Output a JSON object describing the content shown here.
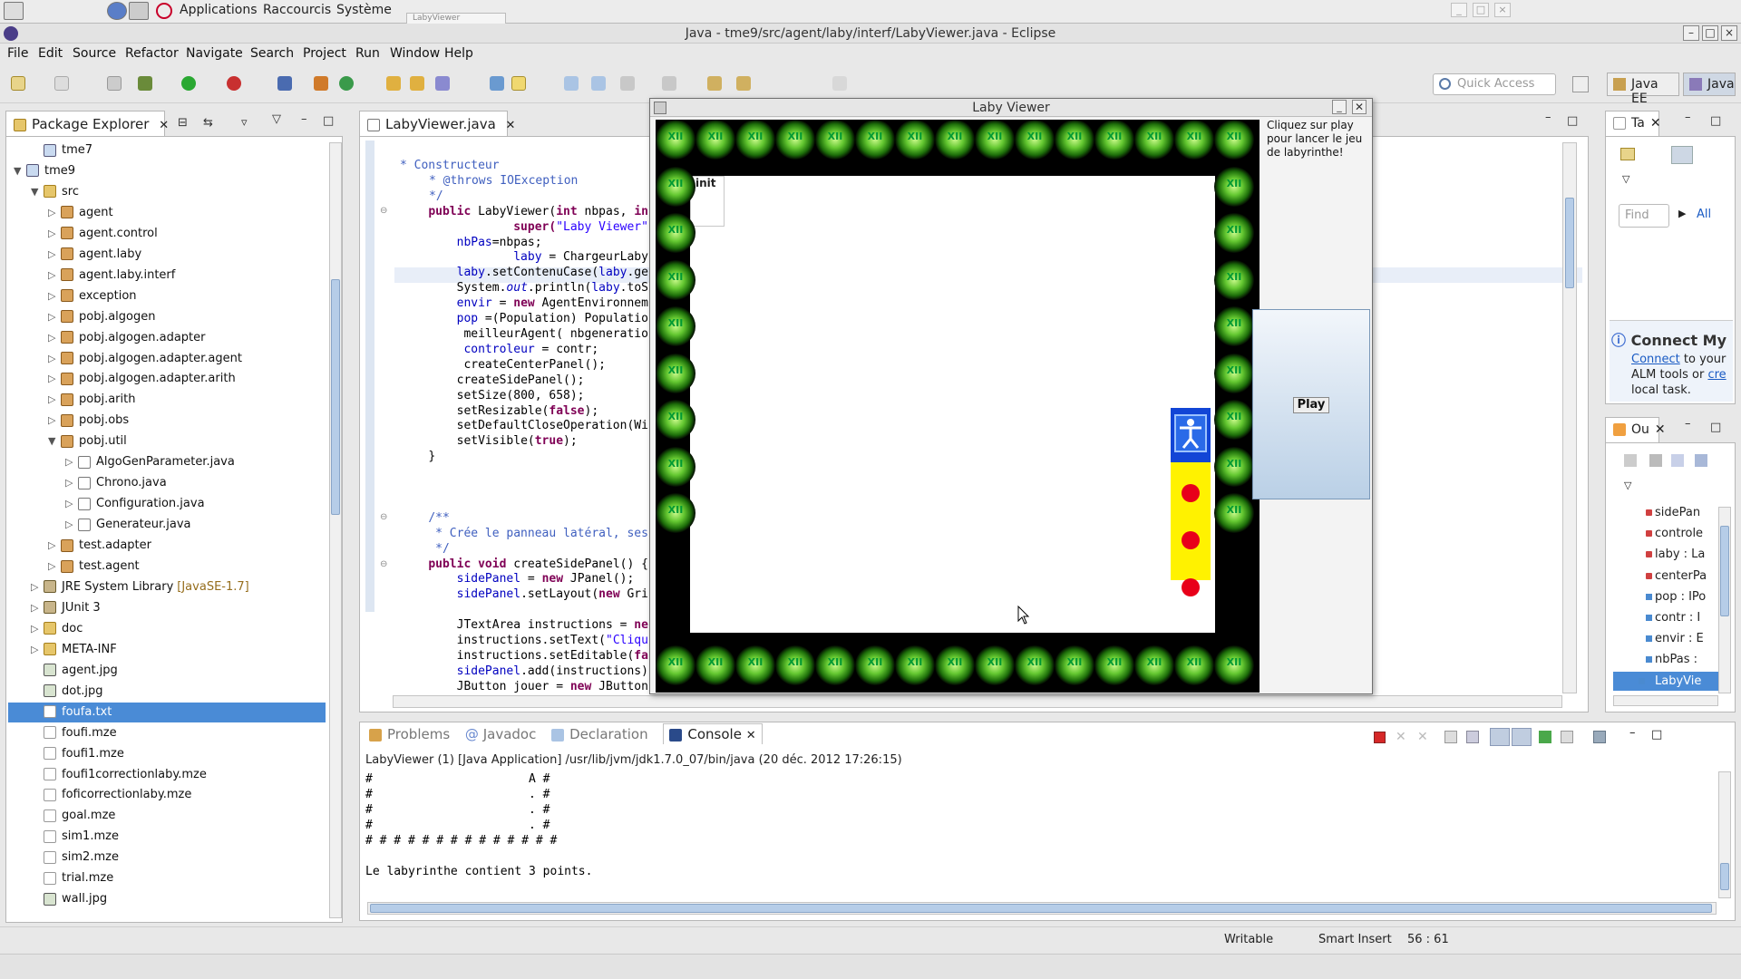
{
  "system_bar": {
    "menus": [
      "Applications",
      "Raccourcis",
      "Système"
    ],
    "task_label": "LabyViewer"
  },
  "window": {
    "title": "Java - tme9/src/agent/laby/interf/LabyViewer.java - Eclipse"
  },
  "menubar": [
    "File",
    "Edit",
    "Source",
    "Refactor",
    "Navigate",
    "Search",
    "Project",
    "Run",
    "Window",
    "Help"
  ],
  "toolbar": {
    "quick_access_placeholder": "Quick Access",
    "perspectives": [
      "Java EE",
      "Java"
    ]
  },
  "package_explorer": {
    "tab_label": "Package Explorer",
    "items": [
      {
        "label": "tme7",
        "icon": "project-icon",
        "level": 1,
        "toggle": ""
      },
      {
        "label": "tme9",
        "icon": "project-icon",
        "level": 0,
        "toggle": "▼"
      },
      {
        "label": "src",
        "icon": "folder-icon",
        "level": 1,
        "toggle": "▼"
      },
      {
        "label": "agent",
        "icon": "package-icon",
        "level": 2,
        "toggle": "▷"
      },
      {
        "label": "agent.control",
        "icon": "package-icon",
        "level": 2,
        "toggle": "▷"
      },
      {
        "label": "agent.laby",
        "icon": "package-icon",
        "level": 2,
        "toggle": "▷"
      },
      {
        "label": "agent.laby.interf",
        "icon": "package-icon",
        "level": 2,
        "toggle": "▷"
      },
      {
        "label": "exception",
        "icon": "package-icon",
        "level": 2,
        "toggle": "▷"
      },
      {
        "label": "pobj.algogen",
        "icon": "package-icon",
        "level": 2,
        "toggle": "▷"
      },
      {
        "label": "pobj.algogen.adapter",
        "icon": "package-icon",
        "level": 2,
        "toggle": "▷"
      },
      {
        "label": "pobj.algogen.adapter.agent",
        "icon": "package-icon",
        "level": 2,
        "toggle": "▷"
      },
      {
        "label": "pobj.algogen.adapter.arith",
        "icon": "package-icon",
        "level": 2,
        "toggle": "▷"
      },
      {
        "label": "pobj.arith",
        "icon": "package-icon",
        "level": 2,
        "toggle": "▷"
      },
      {
        "label": "pobj.obs",
        "icon": "package-icon",
        "level": 2,
        "toggle": "▷"
      },
      {
        "label": "pobj.util",
        "icon": "package-icon",
        "level": 2,
        "toggle": "▼"
      },
      {
        "label": "AlgoGenParameter.java",
        "icon": "java-file-icon",
        "level": 3,
        "toggle": "▷"
      },
      {
        "label": "Chrono.java",
        "icon": "java-file-icon",
        "level": 3,
        "toggle": "▷"
      },
      {
        "label": "Configuration.java",
        "icon": "java-file-icon",
        "level": 3,
        "toggle": "▷"
      },
      {
        "label": "Generateur.java",
        "icon": "java-file-icon",
        "level": 3,
        "toggle": "▷"
      },
      {
        "label": "test.adapter",
        "icon": "package-icon",
        "level": 2,
        "toggle": "▷"
      },
      {
        "label": "test.agent",
        "icon": "package-icon",
        "level": 2,
        "toggle": "▷"
      },
      {
        "label": "JRE System Library",
        "suffix": "[JavaSE-1.7]",
        "icon": "library-icon",
        "level": 1,
        "toggle": "▷"
      },
      {
        "label": "JUnit 3",
        "icon": "library-icon",
        "level": 1,
        "toggle": "▷"
      },
      {
        "label": "doc",
        "icon": "folder-icon",
        "level": 1,
        "toggle": "▷"
      },
      {
        "label": "META-INF",
        "icon": "folder-icon",
        "level": 1,
        "toggle": "▷"
      },
      {
        "label": "agent.jpg",
        "icon": "image-file-icon",
        "level": 1,
        "toggle": ""
      },
      {
        "label": "dot.jpg",
        "icon": "image-file-icon",
        "level": 1,
        "toggle": ""
      },
      {
        "label": "foufa.txt",
        "icon": "text-file-icon",
        "level": 1,
        "toggle": "",
        "selected": true
      },
      {
        "label": "foufi.mze",
        "icon": "text-file-icon",
        "level": 1,
        "toggle": ""
      },
      {
        "label": "foufi1.mze",
        "icon": "text-file-icon",
        "level": 1,
        "toggle": ""
      },
      {
        "label": "foufi1correctionlaby.mze",
        "icon": "text-file-icon",
        "level": 1,
        "toggle": ""
      },
      {
        "label": "foficorrectionlaby.mze",
        "icon": "text-file-icon",
        "level": 1,
        "toggle": ""
      },
      {
        "label": "goal.mze",
        "icon": "text-file-icon",
        "level": 1,
        "toggle": ""
      },
      {
        "label": "sim1.mze",
        "icon": "text-file-icon",
        "level": 1,
        "toggle": ""
      },
      {
        "label": "sim2.mze",
        "icon": "text-file-icon",
        "level": 1,
        "toggle": ""
      },
      {
        "label": "trial.mze",
        "icon": "text-file-icon",
        "level": 1,
        "toggle": ""
      },
      {
        "label": "wall.jpg",
        "icon": "image-file-icon",
        "level": 1,
        "toggle": ""
      }
    ]
  },
  "editor": {
    "tab_label": "LabyViewer.java",
    "code": {
      "l1": "* Constructeur",
      "l2": "* @throws IOException",
      "l3": "*/",
      "l4a": "public ",
      "l4b": "LabyViewer(",
      "l4c": "int",
      "l4d": " nbpas, ",
      "l4e": "in",
      "l5a": "super(",
      "l5b": "\"Laby Viewer\"",
      "l5c": ");",
      "l6a": "nbPas",
      "l6b": "=nbpas;",
      "l7a": "laby",
      "l7b": " = ChargeurLabyrin",
      "l8a": "laby",
      "l8b": ".setContenuCase(",
      "l8c": "laby",
      "l8d": ".ge",
      "l9a": "System.",
      "l9b": "out",
      "l9c": ".println(",
      "l9d": "laby",
      "l9e": ".toS",
      "l10a": "envir",
      "l10b": " = ",
      "l10c": "new",
      "l10d": " AgentEnvironnem",
      "l11a": "pop",
      "l11b": " =(Population) Populatio",
      "l12": " meilleurAgent( nbgeneratio",
      "l13a": " controleur",
      "l13b": " = contr;",
      "l14": " createCenterPanel();",
      "l15": "createSidePanel();",
      "l16": "setSize(800, 658);",
      "l17a": "setResizable(",
      "l17b": "false",
      "l17c": ");",
      "l18": "setDefaultCloseOperation(Wi",
      "l19a": "setVisible(",
      "l19b": "true",
      "l19c": ");",
      "l20": "}",
      "l21": "/**",
      "l22": "* Crée le panneau latéral, ses",
      "l23": "*/",
      "l24a": "public ",
      "l24b": "void",
      "l24c": " createSidePanel() {",
      "l25a": "sidePanel",
      "l25b": " = ",
      "l25c": "new",
      "l25d": " JPanel();",
      "l26a": "sidePanel",
      "l26b": ".setLayout(",
      "l26c": "new",
      "l26d": " Gri",
      "l27a": "JTextArea instructions = ",
      "l27b": "ne",
      "l28a": "instructions.setText(",
      "l28b": "\"Cliqu",
      "l29a": "instructions.setEditable(",
      "l29b": "fa",
      "l30a": "sidePanel",
      "l30b": ".add(instructions)",
      "l31a": "JButton jouer = ",
      "l31b": "new",
      "l31c": " JButton"
    }
  },
  "laby_viewer": {
    "title": "Laby Viewer",
    "init_label": "init",
    "wall_glyph": "XII",
    "instructions": "Cliquez sur play pour lancer le jeu de labyrinthe!",
    "play_label": "Play"
  },
  "right_panels": {
    "tasks_tab": "Ta",
    "find_placeholder": "Find",
    "all_label": "All",
    "connect_title": "Connect My",
    "connect_link": "Connect",
    "connect_text1": " to your",
    "connect_text2": "ALM tools or ",
    "connect_link2": "cre",
    "connect_text3": "local task.",
    "outline_tab": "Ou",
    "outline_items": [
      "sidePan",
      "controle",
      "laby : La",
      "centerPa",
      "pop : IPo",
      "contr : I",
      "envir : E",
      "nbPas :",
      "LabyVie"
    ]
  },
  "bottom_tabs": [
    "Problems",
    "Javadoc",
    "Declaration",
    "Console"
  ],
  "console": {
    "header": "LabyViewer (1) [Java Application] /usr/lib/jvm/jdk1.7.0_07/bin/java (20 déc. 2012 17:26:15)",
    "lines": [
      "#                      A #",
      "#                      . #",
      "#                      . #",
      "#                      . #",
      "# # # # # # # # # # # # # #",
      "",
      "Le labyrinthe contient 3 points."
    ]
  },
  "status_bar": {
    "writable": "Writable",
    "insert_mode": "Smart Insert",
    "position": "56 : 61"
  },
  "colors": {
    "selection": "#4a8bd6",
    "keyword": "#7f0055",
    "string": "#2a00ff",
    "comment": "#3f5fbf",
    "field": "#0000c0",
    "maze_yellow": "#fff200",
    "agent_blue": "#1245d6",
    "dot_red": "#e8001a"
  }
}
